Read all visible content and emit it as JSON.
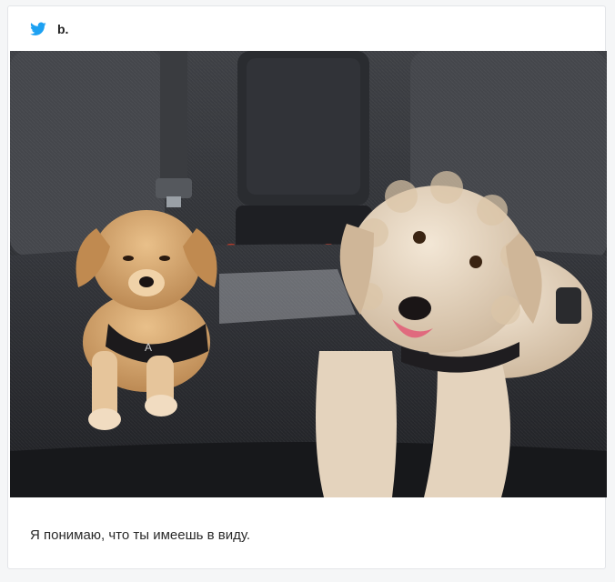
{
  "post": {
    "author": "b.",
    "caption": "Я понимаю, что ты имеешь в виду."
  },
  "icons": {
    "brand": "twitter-bird-icon"
  },
  "colors": {
    "brand": "#1da1f2",
    "card_background": "#ffffff",
    "page_background": "#f5f6f7",
    "card_border": "#e3e5e8"
  }
}
